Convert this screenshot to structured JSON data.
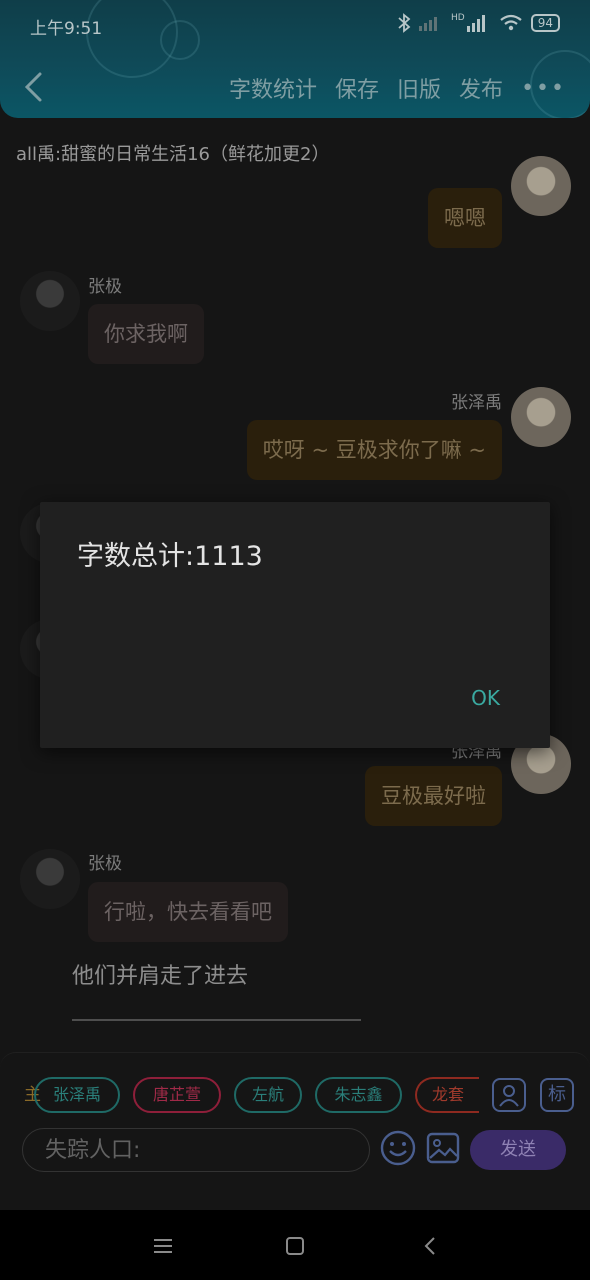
{
  "status_bar": {
    "time": "上午9:51",
    "battery": "94",
    "hd": "HD"
  },
  "header": {
    "menu": [
      "字数统计",
      "保存",
      "旧版",
      "发布"
    ],
    "more": "•••"
  },
  "story_title": "all禹:甜蜜的日常生活16（鲜花加更2）",
  "messages": [
    {
      "side": "right",
      "speaker": "",
      "text": "嗯嗯"
    },
    {
      "side": "left",
      "speaker": "张极",
      "text": "你求我啊"
    },
    {
      "side": "right",
      "speaker": "张泽禹",
      "text": "哎呀 ~ 豆极求你了嘛 ~"
    },
    {
      "side": "right",
      "speaker": "张泽禹",
      "text": "豆极最好啦"
    },
    {
      "side": "left",
      "speaker": "张极",
      "text": "行啦，快去看看吧"
    }
  ],
  "narration": "他们并肩走了进去",
  "role_tag": "主",
  "characters": [
    {
      "name": "张泽禹",
      "color": "#1f6a66"
    },
    {
      "name": "唐芷萱",
      "color": "#8e1f3a"
    },
    {
      "name": "左航",
      "color": "#1f6a66"
    },
    {
      "name": "朱志鑫",
      "color": "#1f6a66"
    },
    {
      "name": "龙套",
      "color": "#8e2a20"
    }
  ],
  "tool_buttons": {
    "mark": "标"
  },
  "input": {
    "placeholder": "失踪人口:",
    "send": "发送"
  },
  "dialog": {
    "message": "字数总计:1113",
    "ok": "OK"
  },
  "icons": [
    "back-icon",
    "more-icon",
    "bluetooth-icon",
    "signal-icon",
    "wifi-icon",
    "battery-icon",
    "person-icon",
    "emoji-icon",
    "image-icon",
    "menu-icon",
    "home-icon",
    "nav-back-icon"
  ]
}
